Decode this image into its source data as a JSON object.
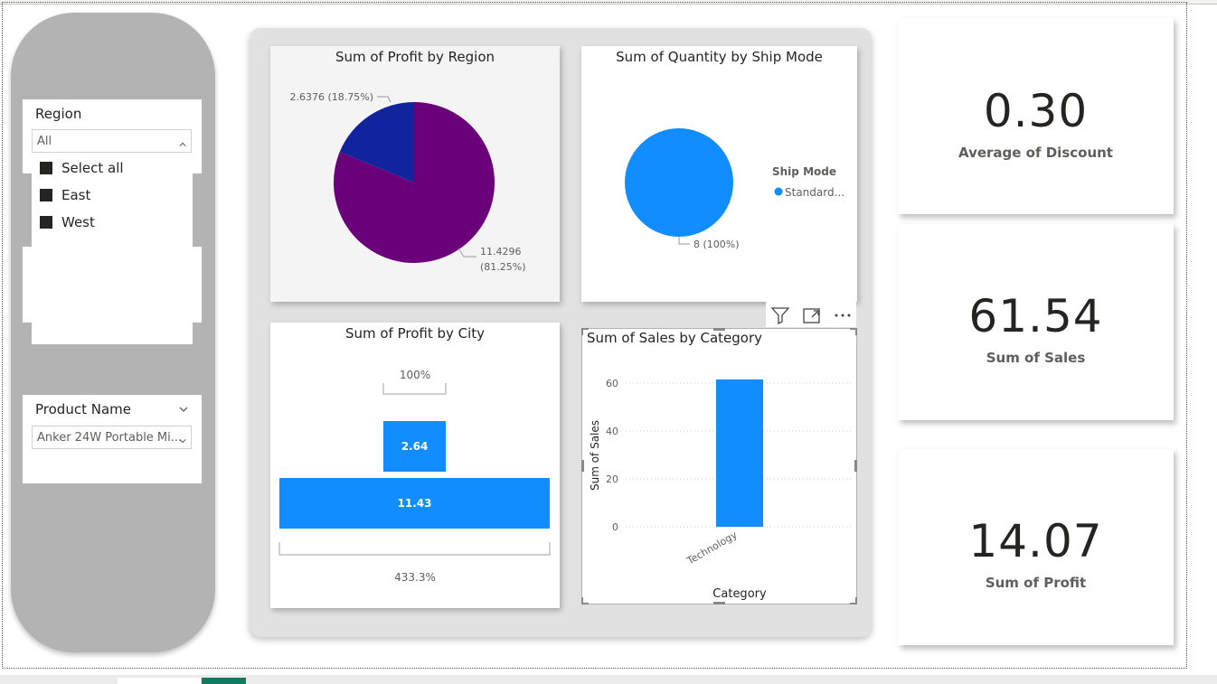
{
  "slicers": {
    "region": {
      "title": "Region",
      "selected": "All",
      "items": [
        "Select all",
        "East",
        "West"
      ]
    },
    "product": {
      "title": "Product Name",
      "selected": "Anker 24W Portable Mi..."
    }
  },
  "visuals": {
    "profit_by_region": {
      "title": "Sum of Profit by Region",
      "label_small": "2.6376 (18.75%)",
      "label_large_1": "11.4296",
      "label_large_2": "(81.25%)"
    },
    "quantity_by_ship_mode": {
      "title": "Sum of Quantity by Ship Mode",
      "legend_title": "Ship Mode",
      "legend_item": "Standard...",
      "slice_label": "8 (100%)"
    },
    "profit_by_city": {
      "title": "Sum of Profit by City",
      "top_pct": "100%",
      "bottom_pct": "433.3%"
    },
    "sales_by_category": {
      "title": "Sum of Sales by Category"
    }
  },
  "cards": [
    {
      "value": "0.30",
      "label": "Average of Discount"
    },
    {
      "value": "61.54",
      "label": "Sum of Sales"
    },
    {
      "value": "14.07",
      "label": "Sum of Profit"
    }
  ],
  "colors": {
    "purple": "#6b007b",
    "navy": "#12239e",
    "blue": "#118dff",
    "pill_gray": "#b3b3b3",
    "group_gray": "#e1e1e1"
  },
  "chart_data": [
    {
      "type": "pie",
      "title": "Sum of Profit by Region",
      "categories": [
        "",
        ""
      ],
      "values": [
        2.6376,
        11.4296
      ],
      "percents": [
        18.75,
        81.25
      ],
      "colors": [
        "#12239e",
        "#6b007b"
      ]
    },
    {
      "type": "pie",
      "title": "Sum of Quantity by Ship Mode",
      "categories": [
        "Standard..."
      ],
      "values": [
        8
      ],
      "percents": [
        100
      ],
      "legend_title": "Ship Mode",
      "legend_position": "right"
    },
    {
      "type": "bar",
      "subtype": "funnel",
      "title": "Sum of Profit by City",
      "values": [
        2.64,
        11.43
      ],
      "value_labels": [
        "2.64",
        "11.43"
      ],
      "percent_labels": [
        "100%",
        "433.3%"
      ]
    },
    {
      "type": "bar",
      "title": "Sum of Sales by Category",
      "categories": [
        "Technology"
      ],
      "values": [
        61.54
      ],
      "xlabel": "Category",
      "ylabel": "Sum of Sales",
      "ylim": [
        0,
        60
      ],
      "yticks": [
        "0",
        "20",
        "40",
        "60"
      ],
      "grid": true
    }
  ]
}
